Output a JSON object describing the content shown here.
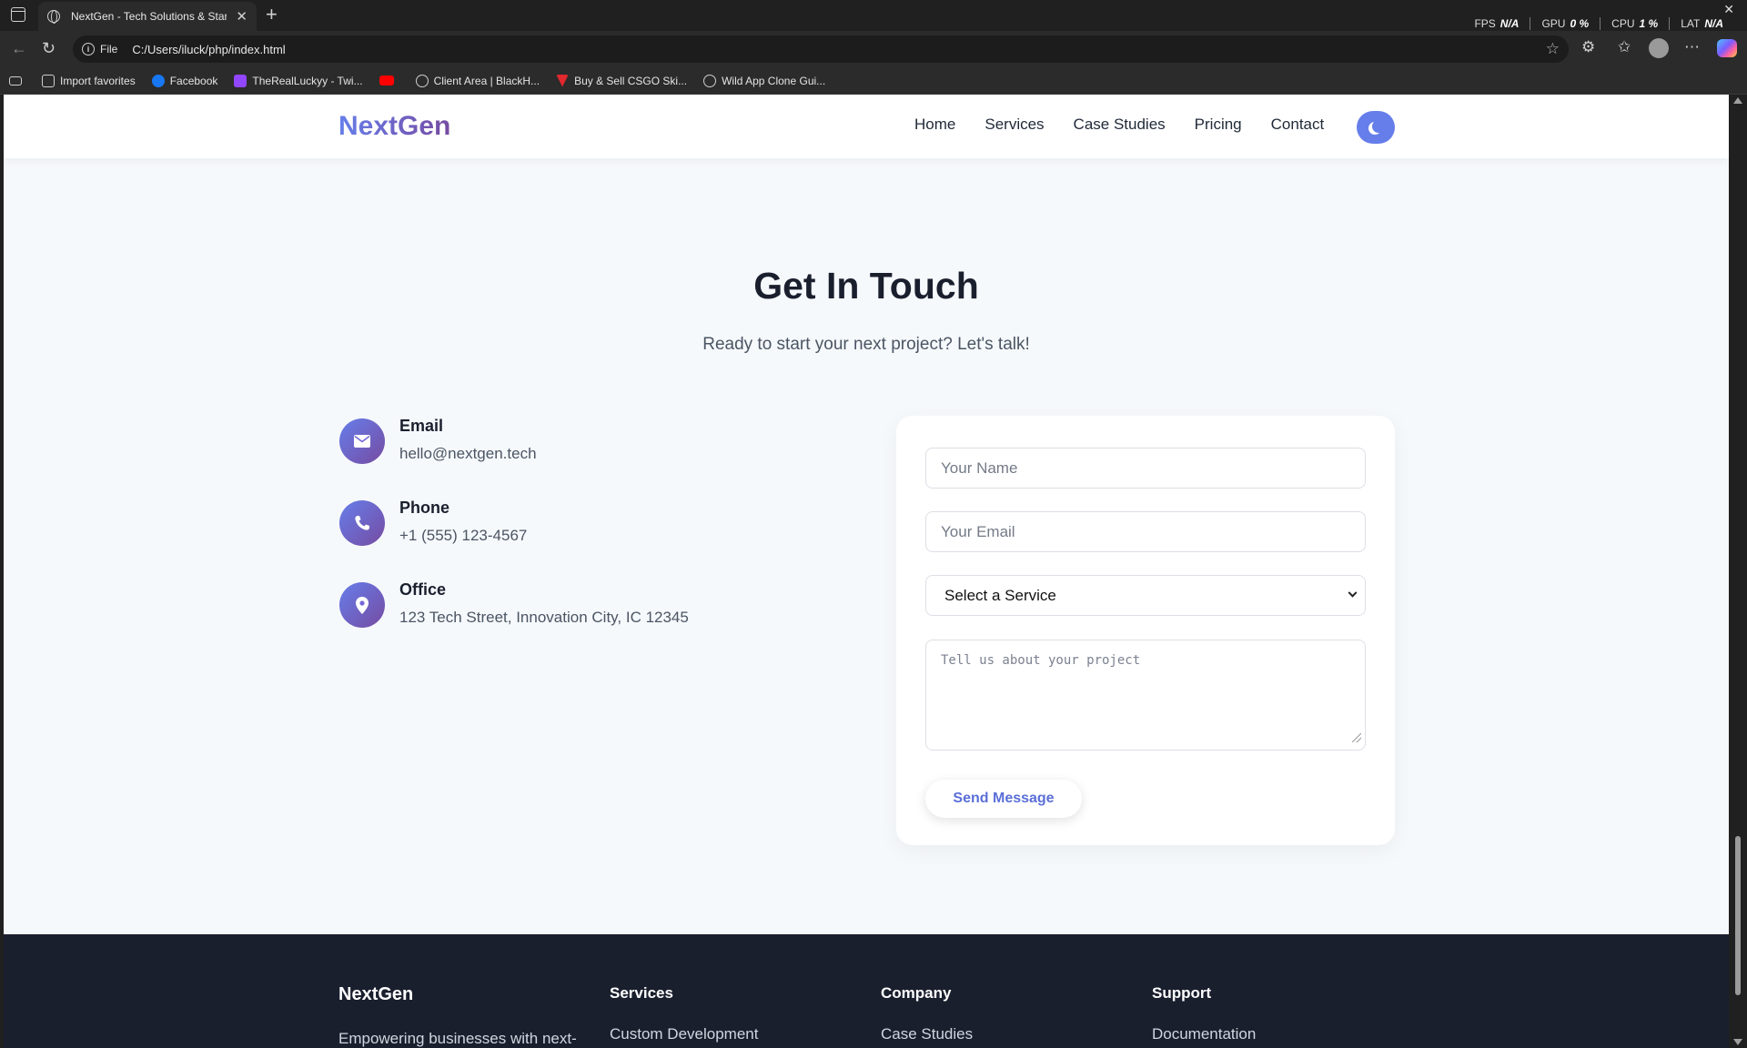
{
  "browser": {
    "tab_title": "NextGen - Tech Solutions & Startups",
    "address_scheme": "File",
    "url": "C:/Users/iluck/php/index.html",
    "perf": [
      {
        "label": "FPS",
        "value": "N/A"
      },
      {
        "label": "GPU",
        "value": "0 %"
      },
      {
        "label": "CPU",
        "value": "1 %"
      },
      {
        "label": "LAT",
        "value": "N/A"
      }
    ],
    "bookmarks": [
      {
        "label": "Import favorites",
        "icon": "import-icon",
        "color": "#d0d0d0"
      },
      {
        "label": "Facebook",
        "icon": "facebook-icon",
        "color": "#1877f2"
      },
      {
        "label": "TheRealLuckyy - Twi...",
        "icon": "twitch-icon",
        "color": "#9146ff"
      },
      {
        "label": "",
        "icon": "youtube-icon",
        "color": "#ff0000"
      },
      {
        "label": "Client Area | BlackH...",
        "icon": "globe-icon",
        "color": "#d0d0d0"
      },
      {
        "label": "Buy & Sell CSGO Ski...",
        "icon": "skinport-icon",
        "color": "#e0282e"
      },
      {
        "label": "Wild App Clone Gui...",
        "icon": "openai-icon",
        "color": "#d0d0d0"
      }
    ]
  },
  "site": {
    "logo": "NextGen",
    "nav": [
      "Home",
      "Services",
      "Case Studies",
      "Pricing",
      "Contact"
    ],
    "accent": "#667eea",
    "accent_dark": "#764ba2"
  },
  "contact": {
    "title": "Get In Touch",
    "subtitle": "Ready to start your next project? Let's talk!",
    "items": [
      {
        "label": "Email",
        "value": "hello@nextgen.tech",
        "icon": "envelope-icon"
      },
      {
        "label": "Phone",
        "value": "+1 (555) 123-4567",
        "icon": "phone-icon"
      },
      {
        "label": "Office",
        "value": "123 Tech Street, Innovation City, IC 12345",
        "icon": "map-pin-icon"
      }
    ],
    "form": {
      "name_placeholder": "Your Name",
      "email_placeholder": "Your Email",
      "service_selected": "Select a Service",
      "message_placeholder": "Tell us about your project",
      "submit_label": "Send Message"
    }
  },
  "footer": {
    "brand": "NextGen",
    "description": "Empowering businesses with next-",
    "columns": [
      {
        "heading": "Services",
        "first_link": "Custom Development"
      },
      {
        "heading": "Company",
        "first_link": "Case Studies"
      },
      {
        "heading": "Support",
        "first_link": "Documentation"
      }
    ]
  }
}
